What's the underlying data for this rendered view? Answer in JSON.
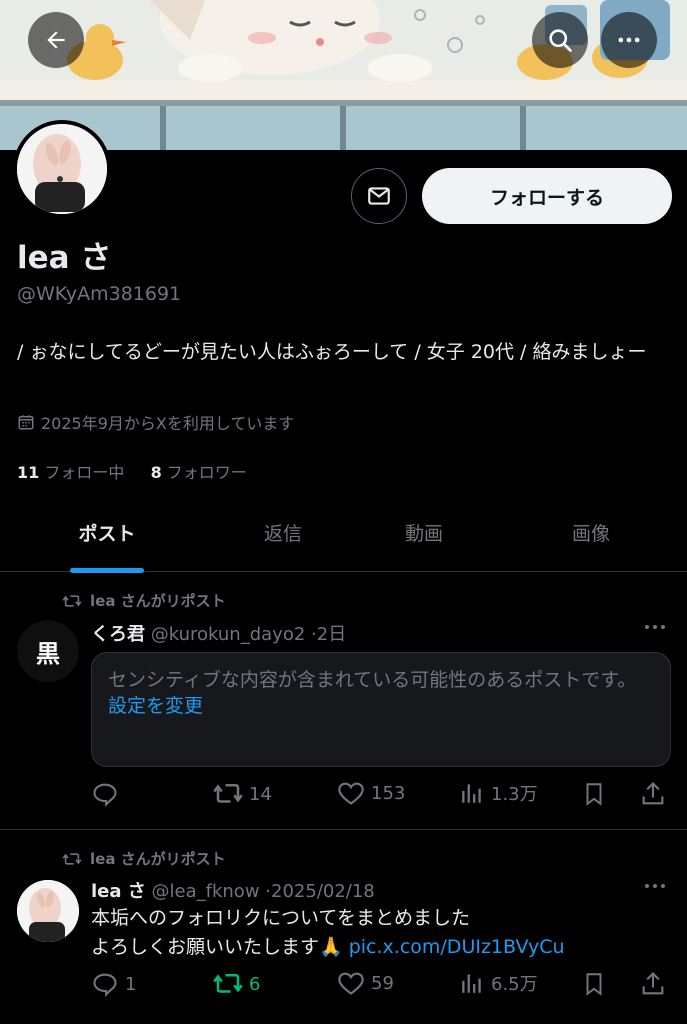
{
  "colors": {
    "accent": "#1d9bf0",
    "repost_active": "#00ba7c",
    "text": "#e7e9ea",
    "muted": "#71767b",
    "background": "#000000"
  },
  "header": {
    "icons": [
      "back-arrow-icon",
      "search-icon",
      "more-dots-icon"
    ]
  },
  "profile": {
    "name": "lea さ",
    "handle": "@WKyAm381691",
    "bio": "/ ぉなにしてるどーが見たい人はふぉろーして / 女子 20代 / 絡みましょー",
    "joined": "2025年9月からXを利用しています",
    "following_count": "11",
    "following_label": "フォロー中",
    "followers_count": "8",
    "followers_label": "フォロワー",
    "follow_button": "フォローする"
  },
  "tabs": [
    {
      "label": "ポスト",
      "active": true
    },
    {
      "label": "返信",
      "active": false
    },
    {
      "label": "動画",
      "active": false
    },
    {
      "label": "画像",
      "active": false
    }
  ],
  "posts": [
    {
      "repost_label": "lea さんがリポスト",
      "author_name": "くろ君",
      "author_handle": "@kurokun_dayo2",
      "time": "2日",
      "avatar_text": "黒",
      "sensitive_text": "センシティブな内容が含まれている可能性のあるポストです。",
      "sensitive_link": "設定を変更",
      "actions": {
        "replies": "",
        "reposts": "14",
        "likes": "153",
        "views": "1.3万"
      }
    },
    {
      "repost_label": "lea さんがリポスト",
      "author_name": "lea さ",
      "author_handle": "@lea_fknow",
      "time": "2025/02/18",
      "text_line1": "本垢へのフォロリクについてをまとめました",
      "text_line2": "よろしくお願いいたします🙏",
      "link": "pic.x.com/DUIz1BVyCu",
      "actions": {
        "replies": "1",
        "reposts": "6",
        "likes": "59",
        "views": "6.5万"
      }
    }
  ]
}
